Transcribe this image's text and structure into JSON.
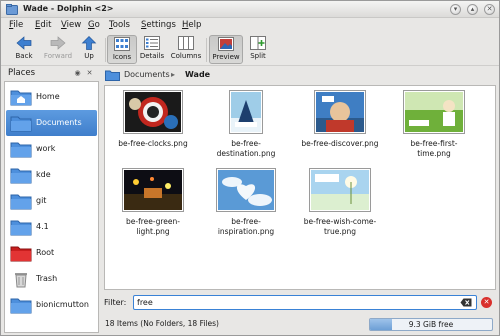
{
  "window": {
    "title": "Wade - Dolphin <2>"
  },
  "menu": [
    {
      "label": "File",
      "u": "F",
      "rest": "ile"
    },
    {
      "label": "Edit",
      "u": "E",
      "rest": "dit"
    },
    {
      "label": "View",
      "u": "V",
      "rest": "iew"
    },
    {
      "label": "Go",
      "u": "G",
      "rest": "o"
    },
    {
      "label": "Tools",
      "u": "T",
      "rest": "ools"
    },
    {
      "label": "Settings",
      "u": "S",
      "rest": "ettings"
    },
    {
      "label": "Help",
      "u": "H",
      "rest": "elp"
    }
  ],
  "toolbar": {
    "back": "Back",
    "forward": "Forward",
    "up": "Up",
    "icons": "Icons",
    "details": "Details",
    "columns": "Columns",
    "preview": "Preview",
    "split": "Split"
  },
  "places": {
    "header": "Places",
    "items": [
      {
        "label": "Home",
        "icon": "home-folder-icon"
      },
      {
        "label": "Documents",
        "icon": "folder-icon",
        "selected": true
      },
      {
        "label": "work",
        "icon": "folder-icon"
      },
      {
        "label": "kde",
        "icon": "folder-icon"
      },
      {
        "label": "git",
        "icon": "folder-icon"
      },
      {
        "label": "4.1",
        "icon": "folder-icon"
      },
      {
        "label": "Root",
        "icon": "red-folder-icon"
      },
      {
        "label": "Trash",
        "icon": "trash-icon"
      },
      {
        "label": "bionicmutton",
        "icon": "folder-icon"
      }
    ]
  },
  "breadcrumb": {
    "parent": "Documents",
    "current": "Wade"
  },
  "files": [
    {
      "name": "be-free-clocks.png"
    },
    {
      "name": "be-free-destination.png"
    },
    {
      "name": "be-free-discover.png"
    },
    {
      "name": "be-free-first-time.png"
    },
    {
      "name": "be-free-green-light.png"
    },
    {
      "name": "be-free-inspiration.png"
    },
    {
      "name": "be-free-wish-come-true.png"
    }
  ],
  "filter": {
    "label": "Filter:",
    "value": "free"
  },
  "status": {
    "text": "18 Items (No Folders, 18 Files)",
    "free_space": "9.3 GiB free",
    "used_fraction": 0.18
  },
  "colors": {
    "selection": "#4a89d4",
    "accent": "#3a82d6"
  }
}
